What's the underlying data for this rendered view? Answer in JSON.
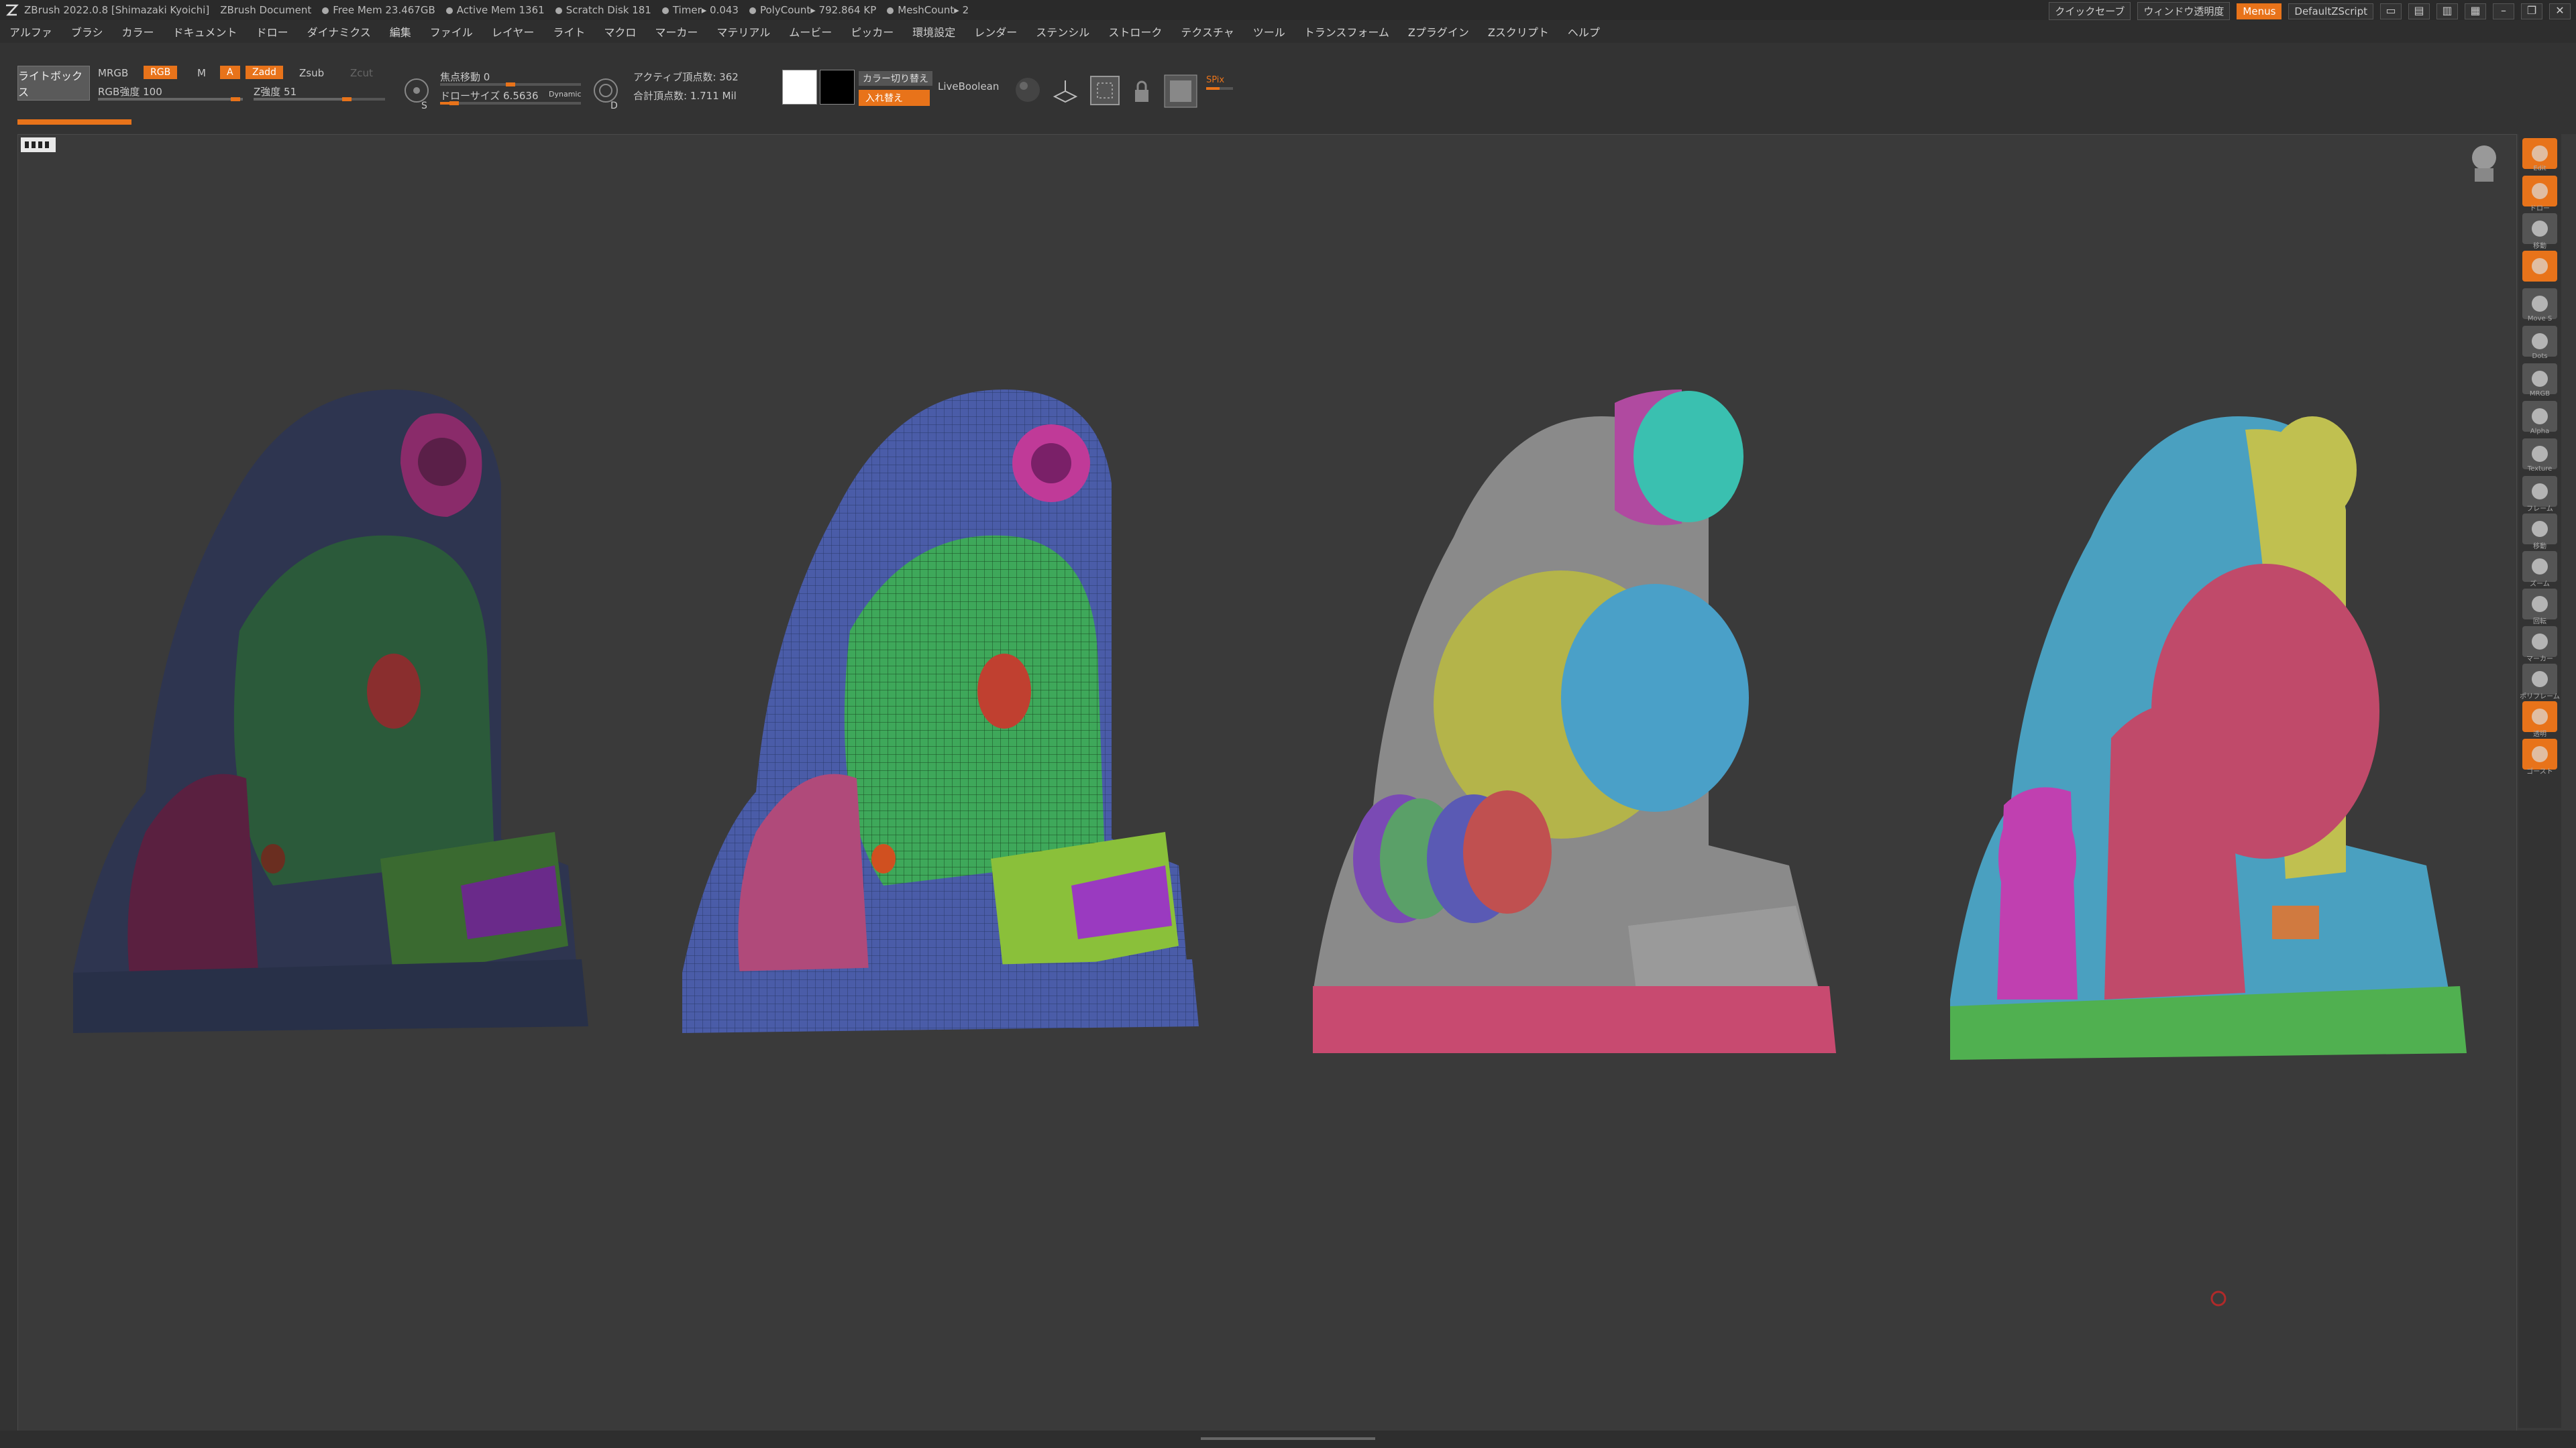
{
  "titlebar": {
    "app": "ZBrush 2022.0.8 [Shimazaki Kyoichi]",
    "doc": "ZBrush Document",
    "free_mem": "Free Mem 23.467GB",
    "active_mem": "Active Mem 1361",
    "scratch": "Scratch Disk 181",
    "timer": "Timer▸ 0.043",
    "polycount": "PolyCount▸ 792.864 KP",
    "meshcount": "MeshCount▸ 2",
    "quicksave": "クイックセーブ",
    "transparency": "ウィンドウ透明度",
    "menus": "Menus",
    "script": "DefaultZScript"
  },
  "menu": [
    "アルファ",
    "ブラシ",
    "カラー",
    "ドキュメント",
    "ドロー",
    "ダイナミクス",
    "編集",
    "ファイル",
    "レイヤー",
    "ライト",
    "マクロ",
    "マーカー",
    "マテリアル",
    "ムービー",
    "ピッカー",
    "環境設定",
    "レンダー",
    "ステンシル",
    "ストローク",
    "テクスチャ",
    "ツール",
    "トランスフォーム",
    "Zプラグイン",
    "Zスクリプト",
    "ヘルプ"
  ],
  "toolbar": {
    "lightbox": "ライトボックス",
    "mrgb": "MRGB",
    "rgb": "RGB",
    "m": "M",
    "a": "A",
    "zadd": "Zadd",
    "zsub": "Zsub",
    "zcut": "Zcut",
    "rgb_intensity": "RGB強度 100",
    "z_intensity": "Z強度 51",
    "focal_shift": "焦点移動 0",
    "draw_size": "ドローサイズ 6.5636",
    "dynamic": "Dynamic",
    "active_points": "アクティブ頂点数: 362",
    "total_points": "合計頂点数: 1.711 Mil",
    "color_swap": "カラー切り替え",
    "swap": "入れ替え",
    "liveboolean": "LiveBoolean",
    "spix": "SPix",
    "s_label": "S",
    "d_label": "D"
  },
  "right_shelf": [
    "Edit",
    "ドロー",
    "移動",
    "",
    "Move S",
    "Dots",
    "MRGB",
    "Alpha",
    "Texture",
    "フレーム",
    "移動",
    "ズーム",
    "回転",
    "マーカー",
    "ポリフレーム",
    "透明",
    "ゴースト"
  ],
  "colors": {
    "accent": "#e8731a",
    "bg": "#3a3a3a",
    "panel": "#333333"
  }
}
